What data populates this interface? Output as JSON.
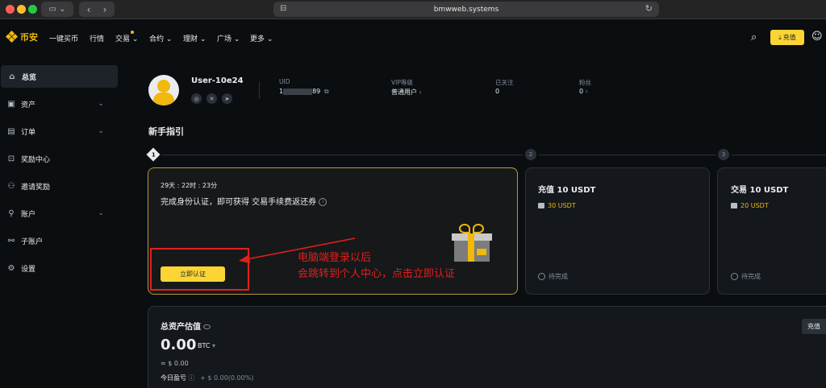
{
  "browser": {
    "url": "bmwweb.systems",
    "icons": {
      "sidebar": "sidebar-icon",
      "back": "chevron-left-icon",
      "forward": "chevron-right-icon",
      "reload": "reload-icon"
    }
  },
  "topnav": {
    "logo": "币安",
    "items": [
      "一键买币",
      "行情",
      "交易",
      "合约",
      "理财",
      "广场",
      "更多"
    ],
    "deposit": "充值",
    "accent": "#f0b90b"
  },
  "sidebar": {
    "items": [
      {
        "label": "总览",
        "active": true
      },
      {
        "label": "资产",
        "chevron": true
      },
      {
        "label": "订单",
        "chevron": true
      },
      {
        "label": "奖励中心"
      },
      {
        "label": "邀请奖励"
      },
      {
        "label": "账户",
        "chevron": true
      },
      {
        "label": "子账户"
      },
      {
        "label": "设置"
      }
    ]
  },
  "profile": {
    "username": "User-10e24",
    "uid_label": "UID",
    "uid_prefix": "1",
    "uid_suffix": "89",
    "vip_label": "VIP等级",
    "vip_value": "普通用户",
    "following_label": "已关注",
    "following_value": "0",
    "followers_label": "粉丝",
    "followers_value": "0"
  },
  "guide": {
    "title": "新手指引",
    "steps": [
      "1",
      "2",
      "3"
    ],
    "main_card": {
      "countdown": "29天 : 22时 : 23分",
      "task": "完成身份认证，即可获得 交易手续费返还券",
      "button": "立即认证"
    },
    "card2": {
      "title": "充值 10 USDT",
      "reward": "30 USDT",
      "status": "待完成"
    },
    "card3": {
      "title": "交易 10 USDT",
      "reward": "20 USDT",
      "status": "待完成"
    }
  },
  "annotation": {
    "line1": "电脑端登录以后",
    "line2": "会跳转到个人中心，点击立即认证",
    "color": "#e0201c"
  },
  "assets": {
    "title": "总资产估值",
    "value": "0.00",
    "unit": "BTC",
    "equiv": "≈ $ 0.00",
    "pnl_label": "今日盈亏",
    "pnl_value": "+ $ 0.00(0.00%)",
    "deposit": "充值"
  }
}
